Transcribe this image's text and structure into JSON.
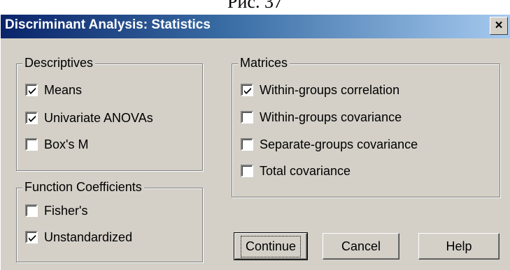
{
  "caption": "Рис. 37",
  "dialog": {
    "title": "Discriminant Analysis: Statistics",
    "close_label": "×"
  },
  "descriptives": {
    "legend": "Descriptives",
    "items": [
      {
        "label": "Means",
        "checked": true
      },
      {
        "label": "Univariate ANOVAs",
        "checked": true
      },
      {
        "label": "Box's M",
        "checked": false
      }
    ]
  },
  "function_coefficients": {
    "legend": "Function Coefficients",
    "items": [
      {
        "label": "Fisher's",
        "checked": false
      },
      {
        "label": "Unstandardized",
        "checked": true
      }
    ]
  },
  "matrices": {
    "legend": "Matrices",
    "items": [
      {
        "label": "Within-groups correlation",
        "checked": true
      },
      {
        "label": "Within-groups covariance",
        "checked": false
      },
      {
        "label": "Separate-groups covariance",
        "checked": false
      },
      {
        "label": "Total covariance",
        "checked": false
      }
    ]
  },
  "buttons": {
    "continue": "Continue",
    "cancel": "Cancel",
    "help": "Help"
  }
}
